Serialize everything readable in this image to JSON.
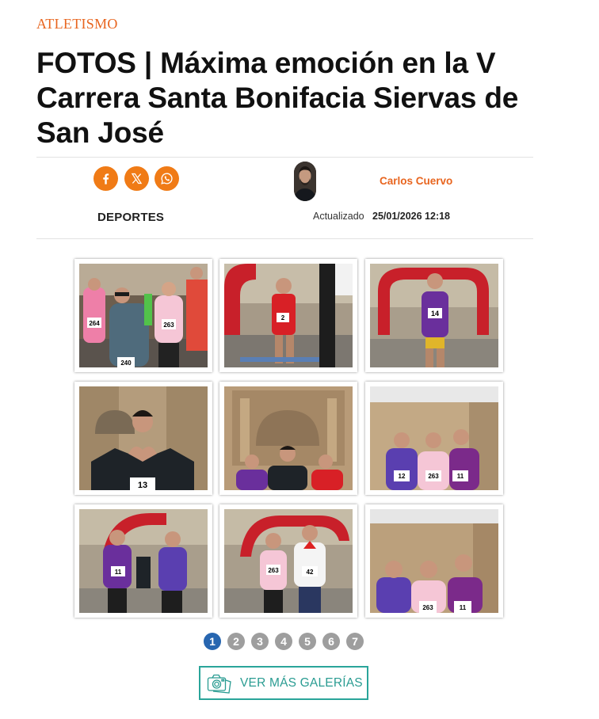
{
  "article": {
    "section": "ATLETISMO",
    "title": "FOTOS | Máxima emoción en la V Carrera Santa Bonifacia Siervas de San José",
    "category": "DEPORTES",
    "author": "Carlos Cuervo",
    "updated_label": "Actualizado",
    "updated_date": "25/01/2026 12:18"
  },
  "share": [
    {
      "name": "facebook-icon"
    },
    {
      "name": "x-icon"
    },
    {
      "name": "whatsapp-icon"
    }
  ],
  "colors": {
    "accent": "#e8651f",
    "share_bg": "#f07b16",
    "pager_active": "#2766b0",
    "pager_inactive": "#9e9e9e",
    "gallery_button": "#2aa59a"
  },
  "gallery": {
    "photos": [
      {
        "bibs": [
          "264",
          "263",
          "240"
        ]
      },
      {
        "bibs": [
          "2"
        ]
      },
      {
        "bibs": [
          "14"
        ]
      },
      {
        "bibs": [
          "13"
        ]
      },
      {
        "bibs": []
      },
      {
        "bibs": [
          "12",
          "263",
          "11"
        ]
      },
      {
        "bibs": [
          "11"
        ]
      },
      {
        "bibs": [
          "263",
          "42"
        ]
      },
      {
        "bibs": [
          "263",
          "11"
        ]
      }
    ],
    "pages": [
      "1",
      "2",
      "3",
      "4",
      "5",
      "6",
      "7"
    ],
    "current_page": "1",
    "more_label": "VER MÁS GALERÍAS"
  }
}
